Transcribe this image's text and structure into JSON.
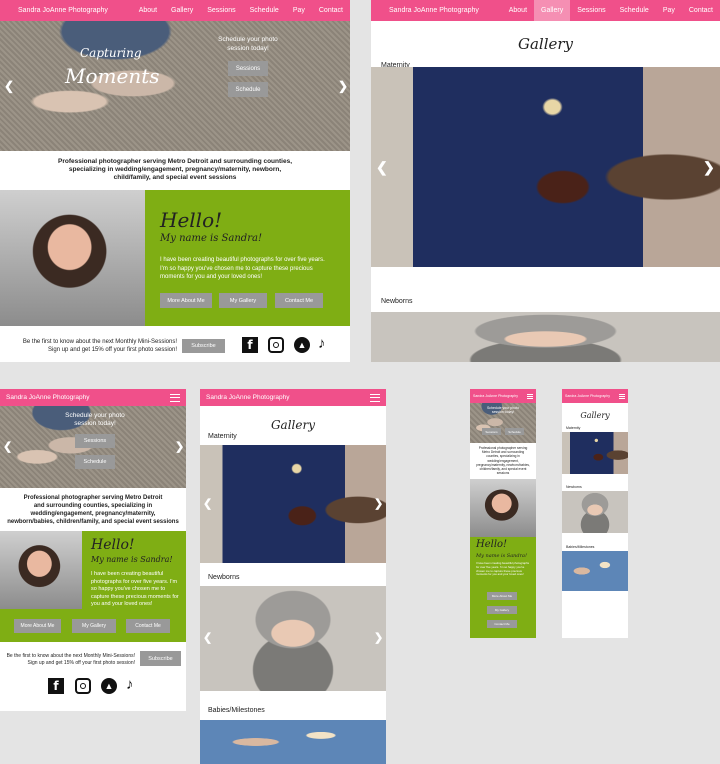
{
  "brand": "Sandra JoAnne Photography",
  "nav": [
    "About",
    "Gallery",
    "Sessions",
    "Schedule",
    "Pay",
    "Contact"
  ],
  "hero": {
    "script_small": "Capturing",
    "script_big": "Moments",
    "cta": "Schedule your photo session today!",
    "cta_line1": "Schedule your photo",
    "cta_line2": "session today!",
    "btn_sessions": "Sessions",
    "btn_schedule": "Schedule"
  },
  "intro": {
    "desktop_l1": "Professional photographer serving Metro Detroit and surrounding counties,",
    "desktop_l2": "specializing in wedding/engagement, pregnancy/maternity, newborn,",
    "desktop_l3": "child/family, and special event sessions",
    "tablet_l1": "Professional photographer serving Metro Detroit",
    "tablet_l2": "and surrounding counties, specializing in",
    "tablet_l3": "wedding/engagement, pregnancy/maternity,",
    "tablet_l4": "newborn/babies, children/family, and special event sessions",
    "phone": "Professional photographer serving Metro Detroit and surrounding counties, specializing in wedding/engagement, pregnancy/maternity, newborn/babies, children/family, and special event sessions"
  },
  "about": {
    "hello": "Hello!",
    "name": "My name is Sandra!",
    "body_l1": "I have been creating beautiful photographs for over five years.",
    "body_l2": "I'm so happy you've chosen me to capture these precious",
    "body_l3": "moments for you and your loved ones!",
    "tablet_body": "I have been creating beautiful photographs for over five years. I'm so happy you've chosen me to capture these precious moments for you and your loved ones!",
    "btn_more": "More About Me",
    "btn_gallery": "My Gallery",
    "btn_contact": "Contact Me"
  },
  "newsletter": {
    "l1": "Be the first to know about the next Monthly Mini-Sessions!",
    "l2": "Sign up and get 15% off your first photo session!",
    "btn": "Subscribe"
  },
  "gallery": {
    "title": "Gallery",
    "maternity": "Maternity",
    "newborns": "Newborns",
    "babies": "Babies/Milestones"
  },
  "icons": [
    "facebook-icon",
    "instagram-icon",
    "twitter-icon",
    "tiktok-icon"
  ],
  "colors": {
    "nav_pink": "#f0508a",
    "active_pink": "#f58fb3",
    "green": "#7fae14",
    "button_gray": "#999999"
  }
}
